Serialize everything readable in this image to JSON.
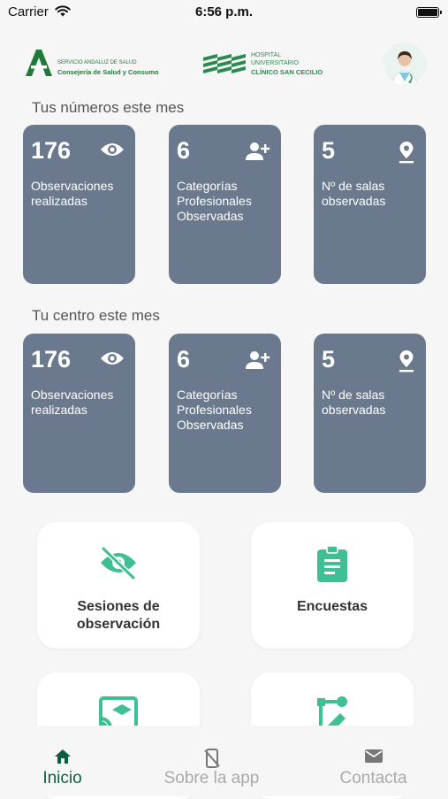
{
  "status_bar": {
    "carrier": "Carrier",
    "time": "6:56 p.m."
  },
  "header": {
    "logo_left": {
      "line1": "SERVICIO ANDALUZ DE SALUD",
      "line2": "Consejería de Salud y Consumo"
    },
    "logo_right": {
      "line1": "HOSPITAL",
      "line2": "UNIVERSITARIO",
      "line3": "CLÍNICO SAN CECILIO"
    }
  },
  "my_numbers": {
    "title": "Tus números este mes",
    "cards": [
      {
        "value": "176",
        "label": "Observaciones\nrealizadas",
        "icon": "eye-icon"
      },
      {
        "value": "6",
        "label": "Categorías\nProfesionales\nObservadas",
        "icon": "person-add-icon"
      },
      {
        "value": "5",
        "label": "Nº de salas\nobservadas",
        "icon": "location-pin-icon"
      }
    ]
  },
  "center_numbers": {
    "title": "Tu centro este mes",
    "cards": [
      {
        "value": "176",
        "label": "Observaciones\nrealizadas",
        "icon": "eye-icon"
      },
      {
        "value": "6",
        "label": "Categorías\nProfesionales\nObservadas",
        "icon": "person-add-icon"
      },
      {
        "value": "5",
        "label": "Nº de salas\nobservadas",
        "icon": "location-pin-icon"
      }
    ]
  },
  "tiles": [
    {
      "label": "Sesiones de\nobservación",
      "icon": "eye-off-icon"
    },
    {
      "label": "Encuestas",
      "icon": "clipboard-icon"
    },
    {
      "label": "",
      "icon": "cast-education-icon"
    },
    {
      "label": "",
      "icon": "flow-edit-icon"
    }
  ],
  "tab_bar": {
    "tabs": [
      {
        "label": "Inicio",
        "icon": "home-icon",
        "active": true
      },
      {
        "label": "Sobre la app",
        "icon": "phone-off-icon",
        "active": false
      },
      {
        "label": "Contacta",
        "icon": "mail-icon",
        "active": false
      }
    ]
  },
  "colors": {
    "accent": "#0d5e40",
    "card": "#6a798d",
    "tile_icon": "#3fbf94",
    "background": "#f6f6f6"
  }
}
